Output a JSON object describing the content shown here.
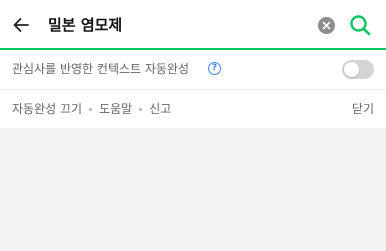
{
  "search": {
    "query": "밀본 염모제",
    "accent_color": "#03c75a",
    "back_icon": "arrow-left-icon",
    "clear_icon": "clear-circle-icon",
    "search_icon": "search-icon"
  },
  "context_option": {
    "label": "관심사를 반영한 컨텍스트 자동완성",
    "help_symbol": "?",
    "toggle_state": "off"
  },
  "footer": {
    "links": [
      "자동완성 끄기",
      "도움말",
      "신고"
    ],
    "close_label": "닫기"
  }
}
